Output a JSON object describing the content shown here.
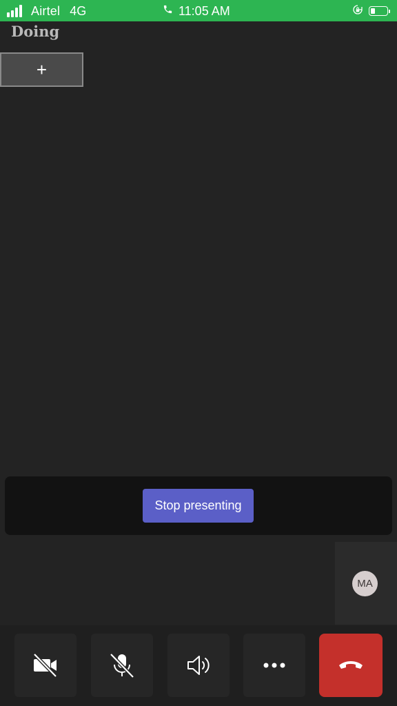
{
  "status_bar": {
    "carrier": "Airtel",
    "network": "4G",
    "time": "11:05 AM",
    "battery_level": 0.3,
    "icons": [
      "signal-bars-icon",
      "phone-icon",
      "rotation-lock-icon",
      "battery-icon"
    ]
  },
  "shared_content": {
    "title": "Doing",
    "add_button_label": "+"
  },
  "presenting": {
    "stop_label": "Stop presenting",
    "accent_color": "#5b5fc7"
  },
  "participant": {
    "initials": "MA"
  },
  "controls": {
    "icons": [
      "camera-off-icon",
      "mic-off-icon",
      "speaker-icon",
      "more-icon",
      "end-call-icon"
    ],
    "end_call_color": "#c4302b"
  },
  "colors": {
    "status_bar": "#2db552",
    "background": "#232323"
  }
}
